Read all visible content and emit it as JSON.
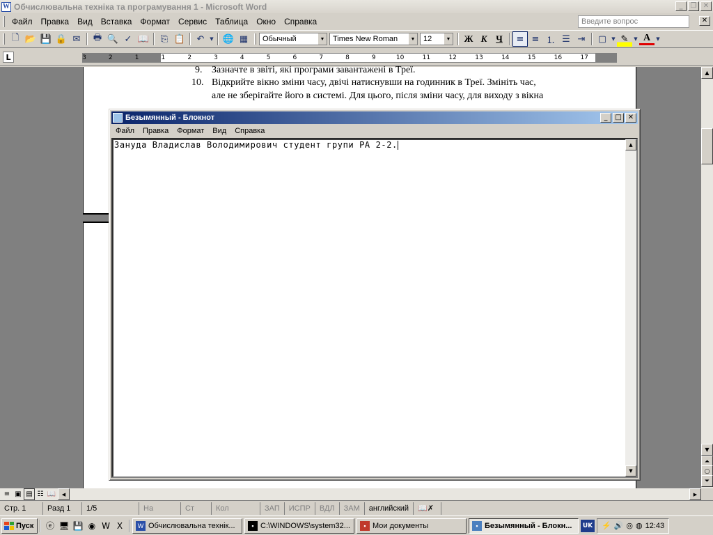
{
  "word": {
    "title": "Обчислювальна техніка та програмування 1 - Microsoft Word",
    "menu": [
      "Файл",
      "Правка",
      "Вид",
      "Вставка",
      "Формат",
      "Сервис",
      "Таблица",
      "Окно",
      "Справка"
    ],
    "ask_placeholder": "Введите вопрос",
    "style_value": "Обычный",
    "font_value": "Times New Roman",
    "size_value": "12",
    "bold_label": "Ж",
    "italic_label": "К",
    "underline_label": "Ч",
    "ruler_labels": [
      "3",
      "2",
      "1",
      "1",
      "2",
      "3",
      "4",
      "5",
      "6",
      "7",
      "8",
      "9",
      "10",
      "11",
      "12",
      "13",
      "14",
      "15",
      "16",
      "17"
    ],
    "doc_lines": [
      {
        "num": "9.",
        "text": "Зазначте в звіті, які програми завантажені в Треї."
      },
      {
        "num": "10.",
        "text": "Відкрийте вікно зміни часу, двічі натиснувши на годинник в Треї. Змініть час,"
      },
      {
        "num": "",
        "text": "але не зберігайте його в системі. Для цього, після зміни часу, для виходу з вікна"
      }
    ],
    "status": {
      "page": "Стр. 1",
      "section": "Разд 1",
      "pages": "1/5",
      "at": "На",
      "line": "Ст",
      "col": "Кол",
      "rec": "ЗАП",
      "trk": "ИСПР",
      "ext": "ВДЛ",
      "ovr": "ЗАМ",
      "language": "английский"
    }
  },
  "notepad": {
    "title": "Безымянный - Блокнот",
    "menu": [
      "Файл",
      "Правка",
      "Формат",
      "Вид",
      "Справка"
    ],
    "content": "Зануда Владислав Володимирович студент групи РА 2-2."
  },
  "taskbar": {
    "start_label": "Пуск",
    "tasks": [
      {
        "label": "Обчислювальна технік...",
        "color": "#2a4fa8",
        "active": false
      },
      {
        "label": "C:\\WINDOWS\\system32...",
        "color": "#000000",
        "active": false
      },
      {
        "label": "Мои документы",
        "color": "#c0392b",
        "active": false
      },
      {
        "label": "Безымянный - Блокн...",
        "color": "#4a7fbf",
        "active": true
      }
    ],
    "lang": "UK",
    "clock": "12:43"
  },
  "colors": {
    "active_title": "#0a246a",
    "face": "#d4d0c8"
  }
}
